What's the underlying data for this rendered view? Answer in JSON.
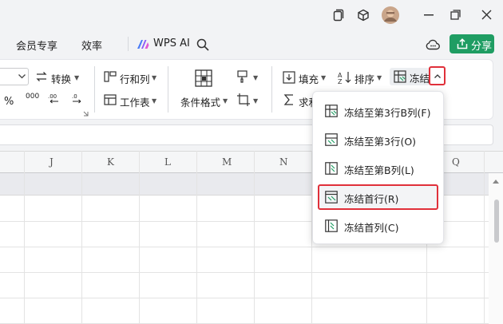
{
  "menu": {
    "member": "会员专享",
    "efficiency": "效率",
    "wps_ai": "WPS AI",
    "share": "分享"
  },
  "ribbon": {
    "convert": "转换",
    "row_col": "行和列",
    "worksheet": "工作表",
    "cond_format": "条件格式",
    "fill": "填充",
    "sort": "排序",
    "freeze": "冻结",
    "sum": "求和",
    "percent": "%",
    "thousands": "000"
  },
  "columns": [
    "J",
    "K",
    "L",
    "M",
    "N",
    "Q"
  ],
  "freeze_menu": {
    "items": [
      {
        "label": "冻结至第3行B列(F)"
      },
      {
        "label": "冻结至第3行(O)"
      },
      {
        "label": "冻结至第B列(L)"
      },
      {
        "label": "冻结首行(R)"
      },
      {
        "label": "冻结首列(C)"
      }
    ]
  },
  "colors": {
    "accent_green": "#1f9d63",
    "highlight_red": "#e0303a"
  }
}
